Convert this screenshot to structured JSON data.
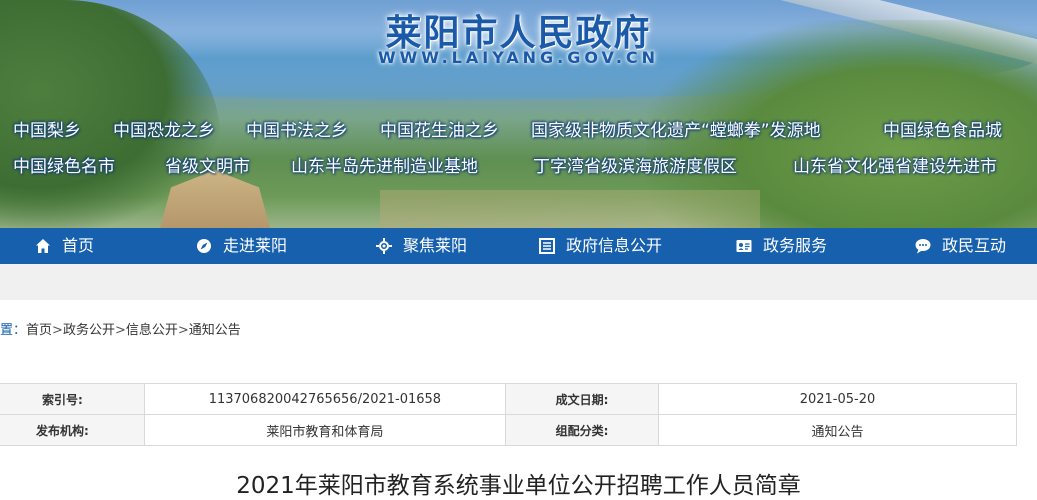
{
  "header": {
    "site_title": "莱阳市人民政府",
    "site_url": "WWW.LAIYANG.GOV.CN",
    "honors_row1": [
      "中国梨乡",
      "中国恐龙之乡",
      "中国书法之乡",
      "中国花生油之乡",
      "国家级非物质文化遗产“螳螂拳”发源地",
      "中国绿色食品城"
    ],
    "honors_row2": [
      "中国绿色名市",
      "省级文明市",
      "山东半岛先进制造业基地",
      "丁字湾省级滨海旅游度假区",
      "山东省文化强省建设先进市"
    ]
  },
  "nav": {
    "items": [
      {
        "label": "首页",
        "icon": "home-icon"
      },
      {
        "label": "走进莱阳",
        "icon": "compass-icon"
      },
      {
        "label": "聚焦莱阳",
        "icon": "focus-icon"
      },
      {
        "label": "政府信息公开",
        "icon": "document-icon"
      },
      {
        "label": "政务服务",
        "icon": "id-card-icon"
      },
      {
        "label": "政民互动",
        "icon": "chat-icon"
      }
    ]
  },
  "breadcrumb": {
    "lead": "置：",
    "items": [
      "首页",
      "政务公开",
      "信息公开",
      "通知公告"
    ],
    "sep": ">"
  },
  "meta": {
    "index_label": "索引号:",
    "index_value": "113706820042765656/2021-01658",
    "date_label": "成文日期:",
    "date_value": "2021-05-20",
    "org_label": "发布机构:",
    "org_value": "莱阳市教育和体育局",
    "category_label": "组配分类:",
    "category_value": "通知公告"
  },
  "article": {
    "title": "2021年莱阳市教育系统事业单位公开招聘工作人员简章"
  },
  "colors": {
    "nav_bg": "#1660ad",
    "title_blue": "#1b5aa8",
    "band_gray": "#f0f0f0"
  }
}
